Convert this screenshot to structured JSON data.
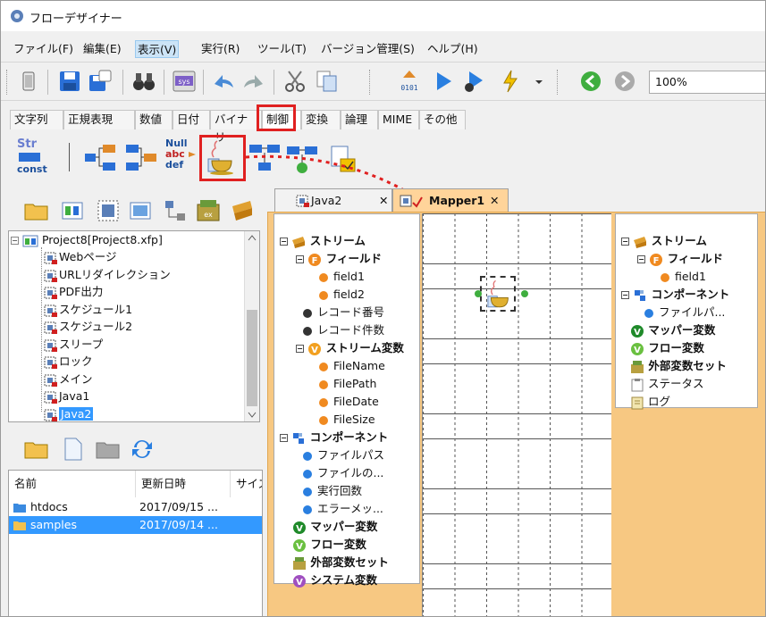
{
  "app": {
    "title": "フローデザイナー"
  },
  "menu": [
    "ファイル(F)",
    "編集(E)",
    "表示(V)",
    "実行(R)",
    "ツール(T)",
    "バージョン管理(S)",
    "ヘルプ(H)"
  ],
  "toolbar": {
    "zoom": "100%"
  },
  "category_tabs": [
    "文字列",
    "正規表現",
    "数値",
    "日付",
    "バイナリ",
    "制御",
    "変換",
    "論理",
    "MIME",
    "その他"
  ],
  "palette_text": {
    "str": "Str",
    "const": "const",
    "null": "Null",
    "abc": "abc",
    "def": "def"
  },
  "project_tree": {
    "root": "Project8[Project8.xfp]",
    "items": [
      "Webページ",
      "URLリダイレクション",
      "PDF出力",
      "スケジュール1",
      "スケジュール2",
      "スリープ",
      "ロック",
      "メイン",
      "Java1",
      "Java2"
    ]
  },
  "file_list": {
    "headers": [
      "名前",
      "更新日時",
      "サイズ"
    ],
    "rows": [
      {
        "name": "htdocs",
        "date": "2017/09/15 ..."
      },
      {
        "name": "samples",
        "date": "2017/09/14 ..."
      }
    ]
  },
  "editor_tabs": [
    "Java2",
    "Mapper1"
  ],
  "stream_left": {
    "stream": "ストリーム",
    "field": "フィールド",
    "fields": [
      "field1",
      "field2"
    ],
    "record_no": "レコード番号",
    "record_count": "レコード件数",
    "stream_var": "ストリーム変数",
    "stream_vars": [
      "FileName",
      "FilePath",
      "FileDate",
      "FileSize"
    ],
    "component": "コンポーネント",
    "component_items": [
      "ファイルパス",
      "ファイルの...",
      "実行回数",
      "エラーメッ..."
    ],
    "mapper_var": "マッパー変数",
    "flow_var": "フロー変数",
    "ext_var_set": "外部変数セット",
    "system_var": "システム変数"
  },
  "stream_right": {
    "stream": "ストリーム",
    "field": "フィールド",
    "field1": "field1",
    "component": "コンポーネント",
    "component_item": "ファイルパ...",
    "mapper_var": "マッパー変数",
    "flow_var": "フロー変数",
    "ext_var_set": "外部変数セット",
    "status": "ステータス",
    "log": "ログ"
  },
  "colors": {
    "accent_red": "#e02020",
    "selection": "#3399ff",
    "editor_bg": "#f7c882"
  }
}
